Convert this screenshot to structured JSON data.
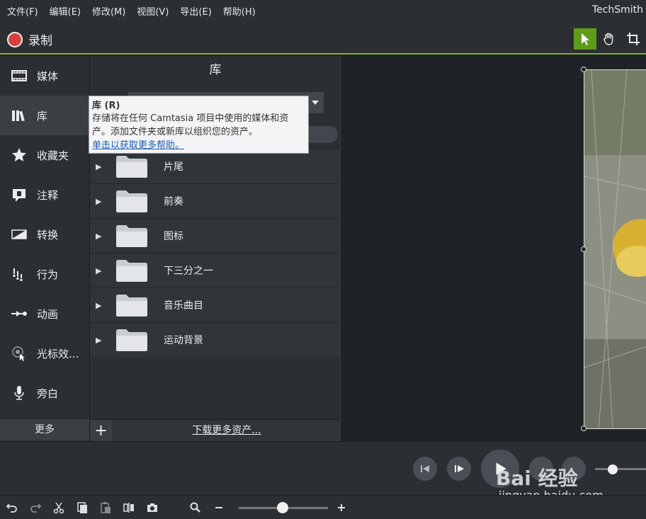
{
  "menu": [
    "文件(F)",
    "编辑(E)",
    "修改(M)",
    "视图(V)",
    "导出(E)",
    "帮助(H)"
  ],
  "brand": "TechSmith",
  "record_label": "录制",
  "sidebar": {
    "items": [
      {
        "label": "媒体",
        "icon": "film-icon"
      },
      {
        "label": "库",
        "icon": "library-icon"
      },
      {
        "label": "收藏夹",
        "icon": "star-icon"
      },
      {
        "label": "注释",
        "icon": "annotation-icon"
      },
      {
        "label": "转换",
        "icon": "transition-icon"
      },
      {
        "label": "行为",
        "icon": "behavior-icon"
      },
      {
        "label": "动画",
        "icon": "animation-icon"
      },
      {
        "label": "光标效...",
        "icon": "cursor-effect-icon"
      },
      {
        "label": "旁白",
        "icon": "microphone-icon"
      }
    ],
    "more_label": "更多"
  },
  "library": {
    "title": "库",
    "folders": [
      "片尾",
      "前奏",
      "图标",
      "下三分之一",
      "音乐曲目",
      "运动背景"
    ],
    "download_label": "下载更多资产..."
  },
  "tooltip": {
    "title": "库 (R)",
    "body": "存储将在任何 Camtasia 项目中使用的媒体和资产。添加文件夹或新库以组织您的资产。",
    "link": "单击以获取更多帮助。"
  },
  "watermark": {
    "main": "Bai 经验",
    "sub": "jingyan.baidu.com"
  },
  "colors": {
    "accent_green": "#7bb51e",
    "record_red": "#d8403c"
  }
}
